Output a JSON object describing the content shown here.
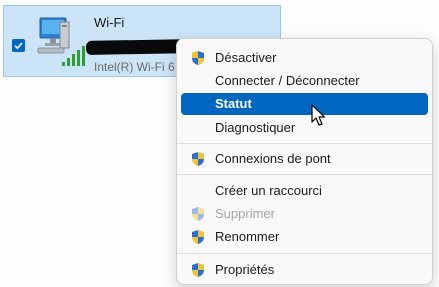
{
  "adapter": {
    "name": "Wi-Fi",
    "device": "Intel(R) Wi-Fi 6",
    "checkbox_checked": true,
    "icon": "network-adapter-icon"
  },
  "menu": {
    "items": [
      {
        "label": "Désactiver",
        "icon": "uac-shield-icon",
        "state": "normal"
      },
      {
        "label": "Connecter / Déconnecter",
        "icon": "",
        "state": "normal"
      },
      {
        "label": "Statut",
        "icon": "",
        "state": "highlighted"
      },
      {
        "label": "Diagnostiquer",
        "icon": "",
        "state": "normal"
      },
      {
        "label": "Connexions de pont",
        "icon": "uac-shield-icon",
        "state": "normal"
      },
      {
        "label": "Créer un raccourci",
        "icon": "",
        "state": "normal"
      },
      {
        "label": "Supprimer",
        "icon": "uac-shield-icon",
        "state": "disabled"
      },
      {
        "label": "Renommer",
        "icon": "uac-shield-icon",
        "state": "normal"
      },
      {
        "label": "Propriétés",
        "icon": "uac-shield-icon",
        "state": "normal"
      }
    ]
  },
  "colors": {
    "selection_bg": "#cce4f7",
    "highlight": "#0067c0",
    "disabled_text": "#a6a6a6"
  }
}
